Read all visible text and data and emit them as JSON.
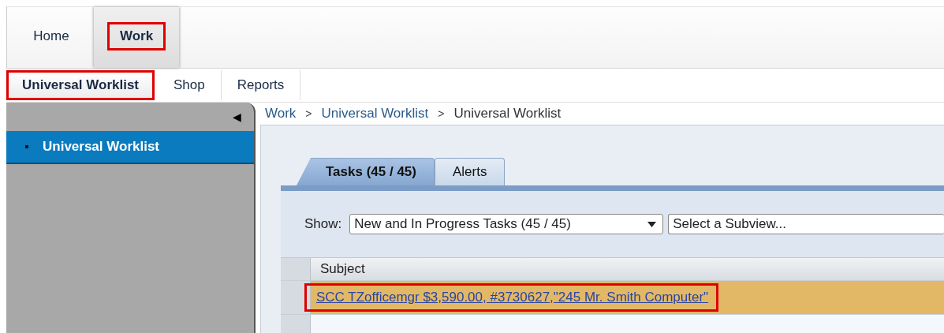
{
  "top_tabs": [
    {
      "label": "Home",
      "selected": false,
      "highlighted": false
    },
    {
      "label": "Work",
      "selected": true,
      "highlighted": true
    }
  ],
  "sub_tabs": [
    {
      "label": "Universal Worklist",
      "selected": true,
      "highlighted": true
    },
    {
      "label": "Shop",
      "selected": false,
      "highlighted": false
    },
    {
      "label": "Reports",
      "selected": false,
      "highlighted": false
    }
  ],
  "sidebar": {
    "collapse_icon": "◀",
    "items": [
      {
        "label": "Universal Worklist",
        "selected": true
      }
    ]
  },
  "breadcrumb": [
    "Work",
    "Universal Worklist",
    "Universal Worklist"
  ],
  "breadcrumb_separator": ">",
  "tabs": [
    {
      "label": "Tasks  (45 / 45)",
      "selected": true
    },
    {
      "label": "Alerts",
      "selected": false
    }
  ],
  "show": {
    "label": "Show:",
    "value": "New and In Progress Tasks  (45 / 45)",
    "subview_placeholder": "Select a Subview..."
  },
  "table": {
    "columns": [
      "Subject"
    ],
    "rows": [
      {
        "subject": "SCC TZofficemgr $3,590.00, #3730627,\"245 Mr. Smith Computer\"",
        "selected": true,
        "highlighted": true
      }
    ]
  }
}
